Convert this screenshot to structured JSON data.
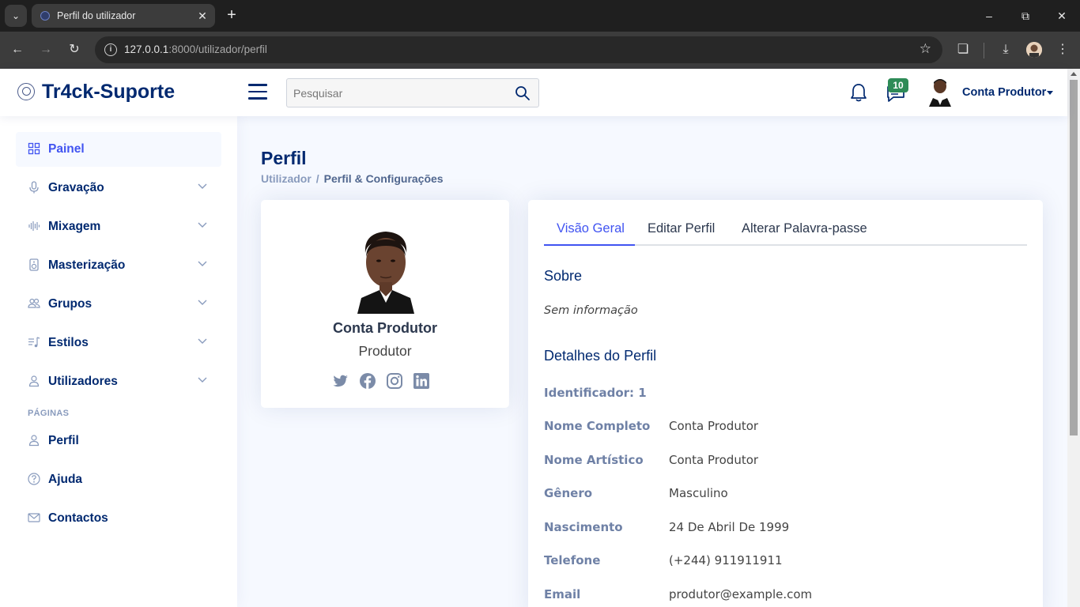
{
  "browser": {
    "tab_title": "Perfil do utilizador",
    "url_host": "127.0.0.1",
    "url_rest": ":8000/utilizador/perfil"
  },
  "header": {
    "logo_text": "Tr4ck-Suporte",
    "search_placeholder": "Pesquisar",
    "messages_badge": "10",
    "user_name": "Conta Produtor"
  },
  "sidebar": {
    "items": [
      {
        "label": "Painel",
        "icon": "grid-icon",
        "active": true
      },
      {
        "label": "Gravação",
        "icon": "mic-icon"
      },
      {
        "label": "Mixagem",
        "icon": "soundwave-icon"
      },
      {
        "label": "Masterização",
        "icon": "speaker-icon"
      },
      {
        "label": "Grupos",
        "icon": "people-icon"
      },
      {
        "label": "Estilos",
        "icon": "music-list-icon"
      },
      {
        "label": "Utilizadores",
        "icon": "person-icon"
      }
    ],
    "pages_heading": "PÁGINAS",
    "pages": [
      {
        "label": "Perfil",
        "icon": "person-icon"
      },
      {
        "label": "Ajuda",
        "icon": "question-icon"
      },
      {
        "label": "Contactos",
        "icon": "envelope-icon"
      }
    ]
  },
  "main": {
    "page_title": "Perfil",
    "breadcrumb": {
      "parent": "Utilizador",
      "current": "Perfil & Configurações"
    },
    "profile_card": {
      "name": "Conta Produtor",
      "role": "Produtor",
      "socials": [
        "twitter-icon",
        "facebook-icon",
        "instagram-icon",
        "linkedin-icon"
      ]
    },
    "tabs": [
      "Visão Geral",
      "Editar Perfil",
      "Alterar Palavra-passe"
    ],
    "active_tab": "Visão Geral",
    "about_title": "Sobre",
    "about_text": "Sem informação",
    "details_title": "Detalhes do Perfil",
    "identifier": "Identificador: 1",
    "details": [
      {
        "label": "Nome Completo",
        "value": "Conta Produtor"
      },
      {
        "label": "Nome Artístico",
        "value": "Conta Produtor"
      },
      {
        "label": "Gênero",
        "value": "Masculino"
      },
      {
        "label": "Nascimento",
        "value": "24 De Abril De 1999"
      },
      {
        "label": "Telefone",
        "value": "(+244) 911911911"
      },
      {
        "label": "Email",
        "value": "produtor@example.com"
      }
    ]
  },
  "colors": {
    "brand": "#012970",
    "accent": "#4154f1",
    "badge": "#2e8b57"
  }
}
